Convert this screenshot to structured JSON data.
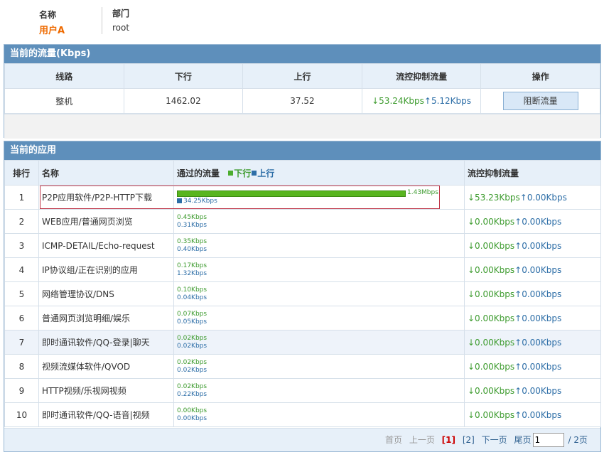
{
  "user": {
    "name_label": "名称",
    "name_value": "用户A",
    "dept_label": "部门",
    "dept_value": "root"
  },
  "traffic": {
    "title": "当前的流量(Kbps)",
    "headers": [
      "线路",
      "下行",
      "上行",
      "流控抑制流量",
      "操作"
    ],
    "row": {
      "line": "整机",
      "down": "1462.02",
      "up": "37.52",
      "ctrl_down": "↓53.24Kbps",
      "ctrl_up": "↑5.12Kbps",
      "action": "阻断流量"
    }
  },
  "apps": {
    "title": "当前的应用",
    "headers": {
      "rank": "排行",
      "name": "名称",
      "flow": "通过的流量",
      "legend_down": "下行",
      "legend_up": "上行",
      "ctrl": "流控抑制流量"
    },
    "rows": [
      {
        "rank": "1",
        "name": "P2P应用软件/P2P-HTTP下载",
        "down": "1.43Mbps",
        "up": "34.25Kbps",
        "ctrl_down": "↓53.23Kbps",
        "ctrl_up": "↑0.00Kbps",
        "bar_fraction": 1.0
      },
      {
        "rank": "2",
        "name": "WEB应用/普通网页浏览",
        "down": "0.45Kbps",
        "up": "0.31Kbps",
        "ctrl_down": "↓0.00Kbps",
        "ctrl_up": "↑0.00Kbps"
      },
      {
        "rank": "3",
        "name": "ICMP-DETAIL/Echo-request",
        "down": "0.35Kbps",
        "up": "0.40Kbps",
        "ctrl_down": "↓0.00Kbps",
        "ctrl_up": "↑0.00Kbps"
      },
      {
        "rank": "4",
        "name": "IP协议组/正在识别的应用",
        "down": "0.17Kbps",
        "up": "1.32Kbps",
        "ctrl_down": "↓0.00Kbps",
        "ctrl_up": "↑0.00Kbps"
      },
      {
        "rank": "5",
        "name": "网络管理协议/DNS",
        "down": "0.10Kbps",
        "up": "0.04Kbps",
        "ctrl_down": "↓0.00Kbps",
        "ctrl_up": "↑0.00Kbps"
      },
      {
        "rank": "6",
        "name": "普通网页浏览明细/娱乐",
        "down": "0.07Kbps",
        "up": "0.05Kbps",
        "ctrl_down": "↓0.00Kbps",
        "ctrl_up": "↑0.00Kbps"
      },
      {
        "rank": "7",
        "name": "即时通讯软件/QQ-登录|聊天",
        "down": "0.02Kbps",
        "up": "0.02Kbps",
        "ctrl_down": "↓0.00Kbps",
        "ctrl_up": "↑0.00Kbps"
      },
      {
        "rank": "8",
        "name": "视频流媒体软件/QVOD",
        "down": "0.02Kbps",
        "up": "0.02Kbps",
        "ctrl_down": "↓0.00Kbps",
        "ctrl_up": "↑0.00Kbps"
      },
      {
        "rank": "9",
        "name": "HTTP视频/乐视网视频",
        "down": "0.02Kbps",
        "up": "0.22Kbps",
        "ctrl_down": "↓0.00Kbps",
        "ctrl_up": "↑0.00Kbps"
      },
      {
        "rank": "10",
        "name": "即时通讯软件/QQ-语音|视频",
        "down": "0.00Kbps",
        "up": "0.00Kbps",
        "ctrl_down": "↓0.00Kbps",
        "ctrl_up": "↑0.00Kbps"
      }
    ]
  },
  "pager": {
    "first": "首页",
    "prev": "上一页",
    "current": "[1]",
    "page2": "[2]",
    "next": "下一页",
    "last": "尾页",
    "input_value": "1",
    "total": "/ 2页"
  },
  "colors": {
    "header_bar": "#5e8fbb",
    "down": "#3d9b2e",
    "up": "#2d6ea7",
    "accent_orange": "#ee6a00"
  }
}
